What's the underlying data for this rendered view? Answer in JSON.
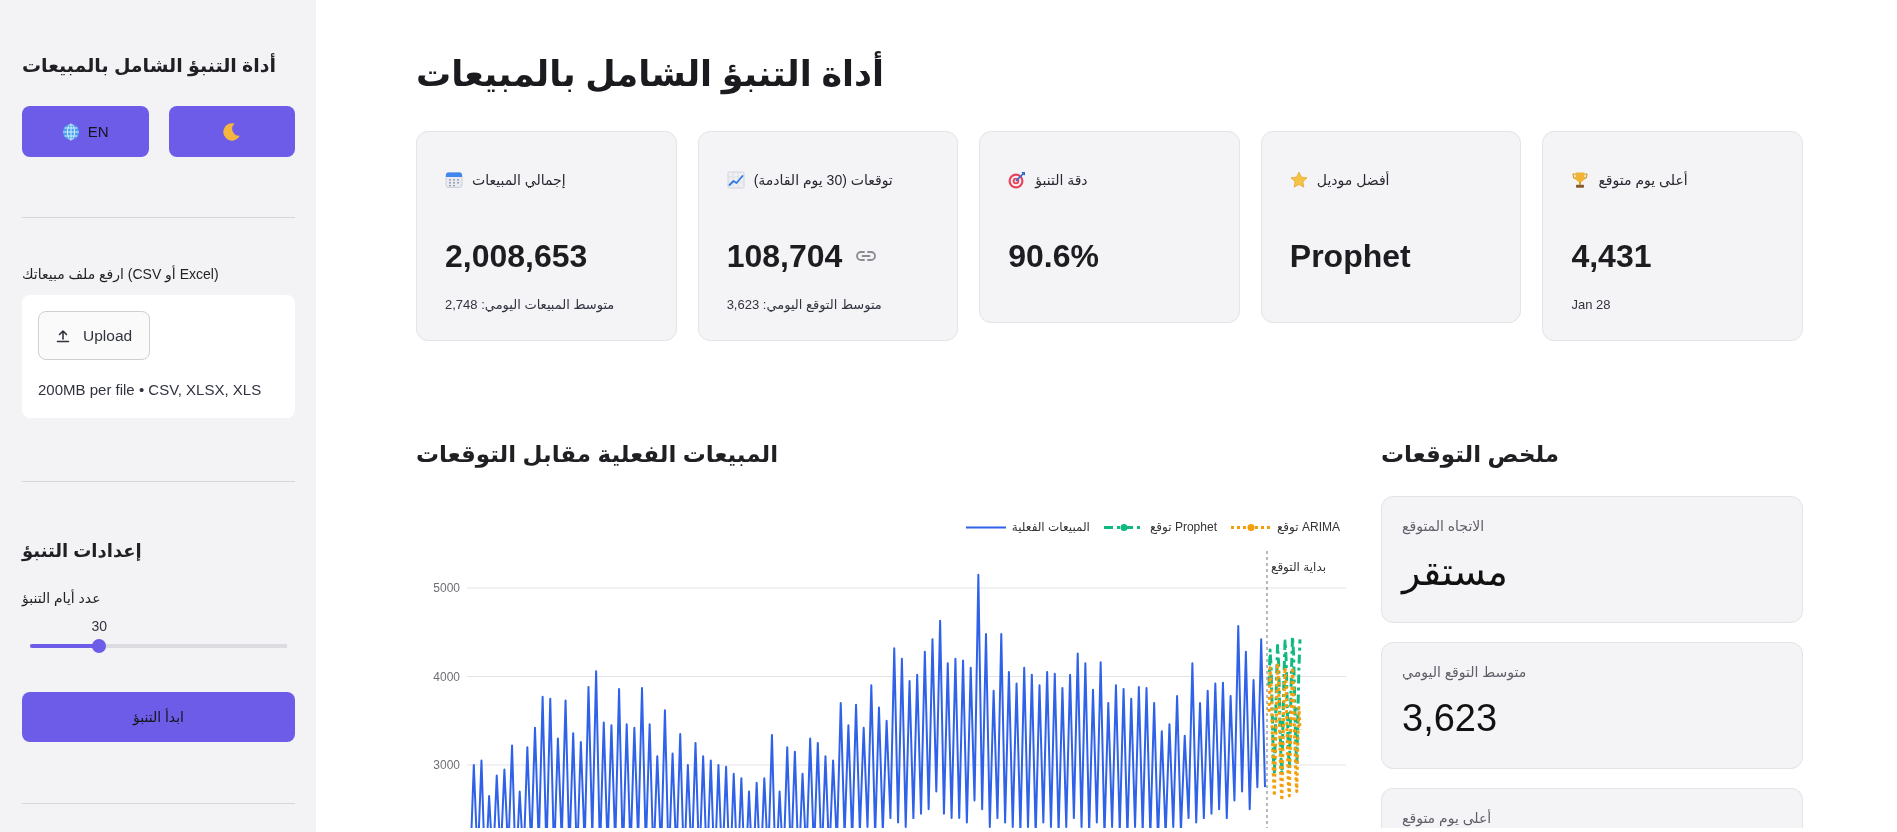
{
  "sidebar": {
    "title": "أداة التنبؤ الشامل بالمبيعات",
    "language_button": "EN",
    "upload": {
      "label": "ارفع ملف مبيعاتك (CSV أو Excel)",
      "button": "Upload",
      "hint": "200MB per file • CSV, XLSX, XLS"
    },
    "settings": {
      "title": "إعدادات التنبؤ",
      "slider": {
        "label": "عدد أيام التنبؤ",
        "value": "30",
        "level": 0.27
      },
      "run_button": "ابدأ التنبؤ"
    }
  },
  "main": {
    "title": "أداة التنبؤ الشامل بالمبيعات",
    "metrics": [
      {
        "label": "أعلى يوم متوقع",
        "value": "4,431",
        "caption": "Jan 28",
        "linked": false
      },
      {
        "label": "أفضل موديل",
        "value": "Prophet",
        "linked": false
      },
      {
        "label": "دقة التنبؤ",
        "value": "90.6%",
        "linked": false
      },
      {
        "label": "توقعات (30 يوم القادمة)",
        "value": "108,704",
        "caption": "متوسط التوقع اليومي: 3,623",
        "linked": true
      },
      {
        "label": "إجمالي المبيعات",
        "value": "2,008,653",
        "caption": "متوسط المبيعات اليومي: 2,748",
        "linked": false
      }
    ],
    "chart_section": {
      "title": "المبيعات الفعلية مقابل التوقعات",
      "legend": [
        {
          "label": "توقع ARIMA",
          "color": "#f59e0b",
          "kind": "dotted"
        },
        {
          "label": "توقع Prophet",
          "color": "#10b981",
          "kind": "dashdot"
        },
        {
          "label": "المبيعات الفعلية",
          "color": "#2f62e8",
          "kind": "solid"
        }
      ],
      "y_axis_labels": [
        "5000",
        "4000",
        "3000"
      ],
      "marker_label": "بداية التوقع"
    },
    "summary": {
      "title": "ملخص التوقعات",
      "cards": [
        {
          "label": "الاتجاه المتوقع",
          "value": "مستقر"
        },
        {
          "label": "متوسط التوقع اليومي",
          "value": "3,623"
        },
        {
          "label": "أعلى يوم متوقع"
        }
      ]
    }
  }
}
